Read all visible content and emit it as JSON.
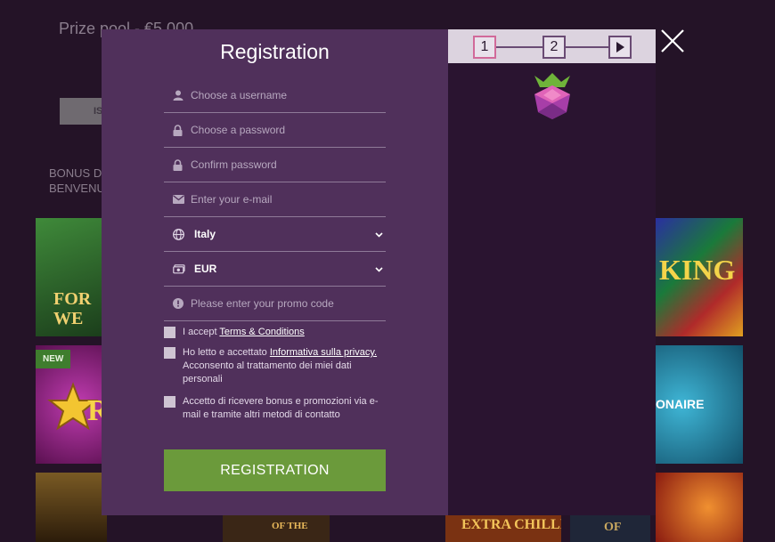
{
  "background": {
    "prize_pool": "Prize pool - €5 000",
    "button_label": "IS",
    "bonus_line1": "BONUS D",
    "bonus_line2": "BENVENU",
    "tiles": [
      {
        "caption": "FOR\nWE",
        "color": "#2e6a2c"
      },
      {
        "caption": "R",
        "color": "#7a1a66",
        "badge": "NEW"
      },
      {
        "caption": "",
        "color": "#6a4a1c"
      },
      {
        "caption": "OF THE",
        "color": "#3a2a1a"
      },
      {
        "caption": "EXTRA CHILLI",
        "color": "#6a2a10"
      },
      {
        "caption": "OF",
        "color": "#20283a"
      },
      {
        "caption": "KING",
        "color": "#2a2a6a"
      },
      {
        "caption": "ONAIRE",
        "color": "#1f6a8a"
      },
      {
        "caption": "",
        "color": "#a0361a"
      }
    ]
  },
  "modal": {
    "title": "Registration",
    "fields": {
      "username": {
        "placeholder": "Choose a username",
        "icon": "user-icon"
      },
      "password": {
        "placeholder": "Choose a password",
        "icon": "lock-icon"
      },
      "confirm": {
        "placeholder": "Confirm password",
        "icon": "lock-icon"
      },
      "email": {
        "placeholder": "Enter your e-mail",
        "icon": "envelope-icon"
      },
      "country": {
        "value": "Italy",
        "icon": "globe-icon"
      },
      "currency": {
        "value": "EUR",
        "icon": "money-icon"
      },
      "promo": {
        "placeholder": "Please enter your promo code",
        "icon": "info-icon"
      }
    },
    "checks": {
      "terms_prefix": "I accept",
      "terms_link": "Terms & Conditions",
      "privacy_prefix": "Ho letto e accettato",
      "privacy_link": "Informativa sulla privacy.",
      "privacy_rest": "Acconsento al trattamento dei miei dati personali",
      "marketing": "Accetto di ricevere bonus e promozioni via e-mail e tramite altri metodi di contatto"
    },
    "submit_label": "REGISTRATION",
    "stepper": {
      "step1": "1",
      "step2": "2"
    },
    "colors": {
      "panel": "#50305b",
      "accent_green": "#6b9a3b",
      "logo_pink": "#d8389a"
    }
  }
}
